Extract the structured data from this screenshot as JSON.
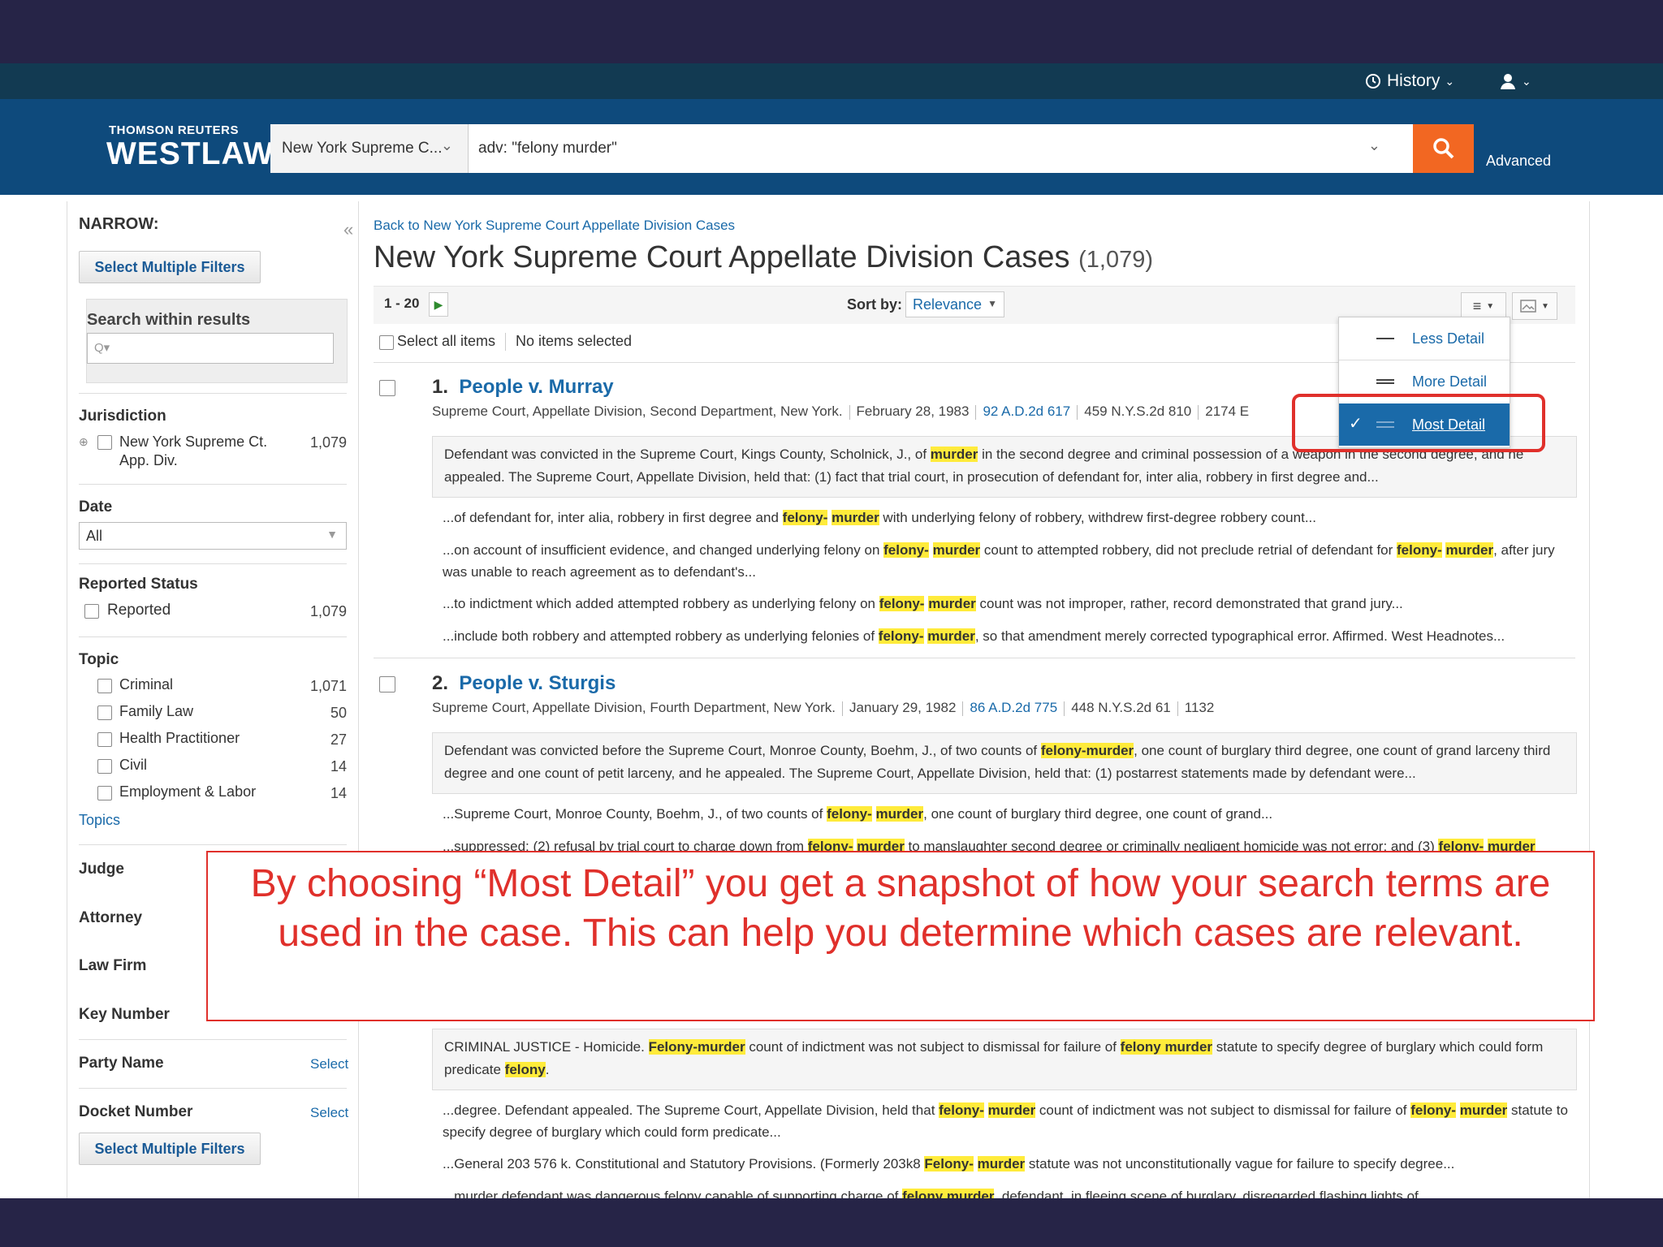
{
  "header": {
    "history_label": "History",
    "brand_top": "THOMSON REUTERS",
    "brand_name": "WESTLAW",
    "jurisdiction_value": "New York Supreme C...",
    "search_value": "adv: \"felony murder\"",
    "advanced_label": "Advanced"
  },
  "sidebar": {
    "narrow_label": "NARROW:",
    "select_multiple": "Select Multiple Filters",
    "search_within_label": "Search within results",
    "search_within_placeholder": "Q▾",
    "jurisdiction_label": "Jurisdiction",
    "jurisdiction_item": "New York Supreme Ct. App. Div.",
    "jurisdiction_count": "1,079",
    "date_label": "Date",
    "date_value": "All",
    "reported_status_label": "Reported Status",
    "reported_item": "Reported",
    "reported_count": "1,079",
    "topic_label": "Topic",
    "topics": [
      {
        "label": "Criminal",
        "count": "1,071"
      },
      {
        "label": "Family Law",
        "count": "50"
      },
      {
        "label": "Health Practitioner",
        "count": "27"
      },
      {
        "label": "Civil",
        "count": "14"
      },
      {
        "label": "Employment & Labor",
        "count": "14"
      }
    ],
    "topics_link": "Topics",
    "judge_label": "Judge",
    "attorney_label": "Attorney",
    "law_firm_label": "Law Firm",
    "key_number_label": "Key Number",
    "party_name_label": "Party Name",
    "docket_number_label": "Docket Number",
    "select_link": "Select"
  },
  "main": {
    "back_link": "Back to New York Supreme Court Appellate Division Cases",
    "page_title": "New York Supreme Court Appellate Division Cases",
    "result_count": "(1,079)",
    "pagination": "1 - 20",
    "sort_label": "Sort by:",
    "sort_value": "Relevance",
    "select_all": "Select all items",
    "no_items": "No items selected"
  },
  "dropdown": {
    "less": "Less Detail",
    "more": "More Detail",
    "most": "Most Detail"
  },
  "results": [
    {
      "number": "1.",
      "title": "People v. Murray",
      "court": "Supreme Court, Appellate Division, Second Department, New York.",
      "date": "February 28, 1983",
      "cite1": "92 A.D.2d 617",
      "cite2": "459 N.Y.S.2d 810",
      "cite3": "2174 E"
    },
    {
      "number": "2.",
      "title": "People v. Sturgis",
      "court": "Supreme Court, Appellate Division, Fourth Department, New York.",
      "date": "January 29, 1982",
      "cite1": "86 A.D.2d 775",
      "cite2": "448 N.Y.S.2d 61",
      "cite3": "1132"
    }
  ],
  "texts": {
    "r1_abs_a": "Defendant was convicted in the Supreme Court, Kings County, Scholnick, J., of ",
    "r1_abs_b": "murder",
    "r1_abs_c": " in the second degree and criminal possession of a weapon in the second degree, and he appealed.   The Supreme Court, Appellate Division, held that:  (1) fact that trial court, in prosecution of defendant for, inter alia, robbery in first degree and...",
    "r1_s1_a": "...of defendant for, inter alia, robbery in first degree and ",
    "felony_dash": "felony-",
    "murder": "murder",
    "felony_murder": "felony-murder",
    "felony_murder_cap": "Felony-murder",
    "felony_plain": "felony",
    "felony_dash_cap": "Felony-",
    "felony_murder_sp": "felony murder",
    "r1_s1_b": " with underlying felony of robbery, withdrew first-degree robbery count...",
    "r1_s2_a": "...on account of insufficient evidence, and changed underlying felony on ",
    "r1_s2_b": " count to attempted robbery, did not preclude retrial of defendant for ",
    "r1_s2_c": ", after jury was unable to reach agreement as to defendant's...",
    "r1_s3_a": "...to indictment which added attempted robbery as underlying felony on ",
    "r1_s3_b": " count was not improper, rather, record demonstrated that grand jury...",
    "r1_s4_a": "...include both robbery and attempted robbery as underlying felonies of ",
    "r1_s4_b": ", so that amendment merely corrected typographical error. Affirmed. West Headnotes...",
    "r2_abs_a": "Defendant was convicted before the Supreme Court, Monroe County, Boehm, J., of two counts of ",
    "r2_abs_b": ", one count of burglary third degree, one count of grand larceny third degree and one count of petit larceny, and he appealed.   The Supreme Court, Appellate Division, held that:  (1) postarrest statements made by defendant were...",
    "r2_s1_a": "...Supreme Court, Monroe County, Boehm, J., of two counts of ",
    "r2_s1_b": ", one count of burglary third degree, one count of grand...",
    "r2_s2_a": "...suppressed;  (2) refusal by trial court to charge down from ",
    "r2_s2_b": " to manslaughter second degree or criminally negligent homicide was not error;  and (3) ",
    "r3_abs_a": "CRIMINAL JUSTICE - Homicide. ",
    "r3_abs_b": " count of indictment was not subject to dismissal for failure of ",
    "r3_abs_c": " statute to specify degree of burglary which could form predicate ",
    "r3_abs_d": ".",
    "r3_s1_a": "...degree.   Defendant appealed.   The Supreme Court, Appellate Division, held that ",
    "r3_s1_b": " count of indictment was not subject to dismissal for failure of ",
    "r3_s1_c": " statute to specify degree of burglary which could form predicate...",
    "r3_s2_a": "...General 203 576 k. Constitutional and Statutory Provisions. (Formerly 203k8 ",
    "r3_s2_b": " statute was not unconstitutionally vague for failure to specify degree...",
    "r3_s3_a": "...murder defendant was dangerous felony capable of supporting charge of ",
    "r3_s3_b": ", defendant, in fleeing scene of burglary, disregarded flashing lights of..."
  },
  "callout": {
    "text": "By choosing “Most Detail” you get a snapshot of how your search terms are used in the case.  This can help you determine which cases are relevant."
  },
  "colors": {
    "top_band": "#262447",
    "header": "#0e4a7c",
    "search_button": "#f26722",
    "highlight": "#ffeb3b",
    "callout_red": "#e0302b",
    "link": "#1a6aa9"
  }
}
